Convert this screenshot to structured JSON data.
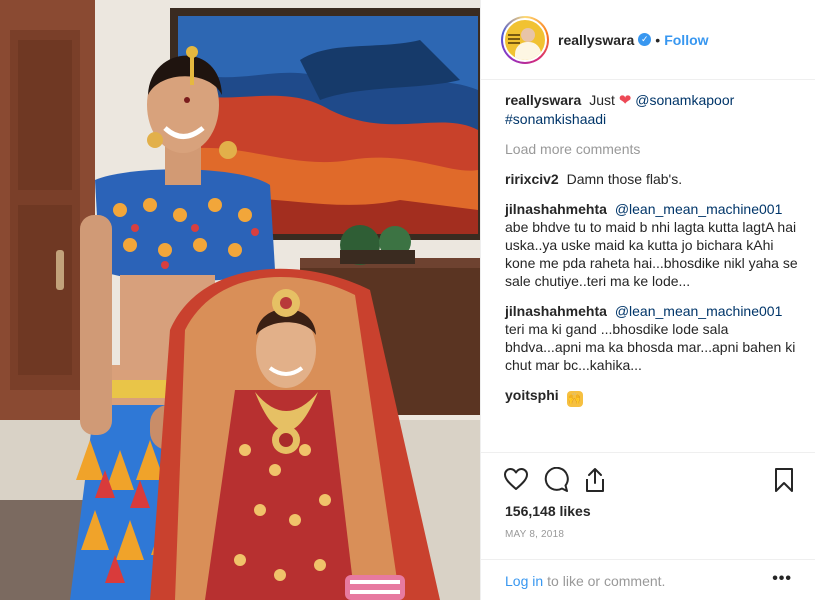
{
  "post": {
    "username": "reallyswara",
    "verified_badge": "✓",
    "separator": "•",
    "follow_label": "Follow",
    "caption_prefix": "Just",
    "caption_mention": "@sonamkapoor",
    "caption_hashtag": "#sonamkishaadi",
    "load_more_label": "Load more comments",
    "comments": [
      {
        "user": "ririxciv2",
        "text": "Damn those flab's."
      },
      {
        "user": "jilnashahmehta",
        "mention": "@lean_mean_machine001",
        "text": "abe bhdve tu to maid b nhi lagta kutta lagtA hai uska..ya uske maid ka kutta jo bichara kAhi kone me pda raheta hai...bhosdike nikl yaha se sale chutiye..teri ma ke lode..."
      },
      {
        "user": "jilnashahmehta",
        "mention": "@lean_mean_machine001",
        "text": "teri ma ki gand ...bhosdike lode sala bhdva...apni ma ka bhosda mar...apni bahen ki chut mar bc...kahika..."
      },
      {
        "user": "yoitsphi",
        "emoji": "🙌"
      }
    ],
    "likes": "156,148 likes",
    "date": "MAY 8, 2018",
    "login_label": "Log in",
    "login_suffix": "to like or comment.",
    "more_label": "•••"
  },
  "icons": {
    "heart": "heart-icon",
    "comment": "comment-icon",
    "share": "share-icon",
    "bookmark": "bookmark-icon",
    "caption_heart": "❤"
  },
  "colors": {
    "link_blue": "#3897f0",
    "mention_navy": "#003569",
    "muted_gray": "#999999",
    "text": "#262626",
    "heart_red": "#ed4956"
  }
}
